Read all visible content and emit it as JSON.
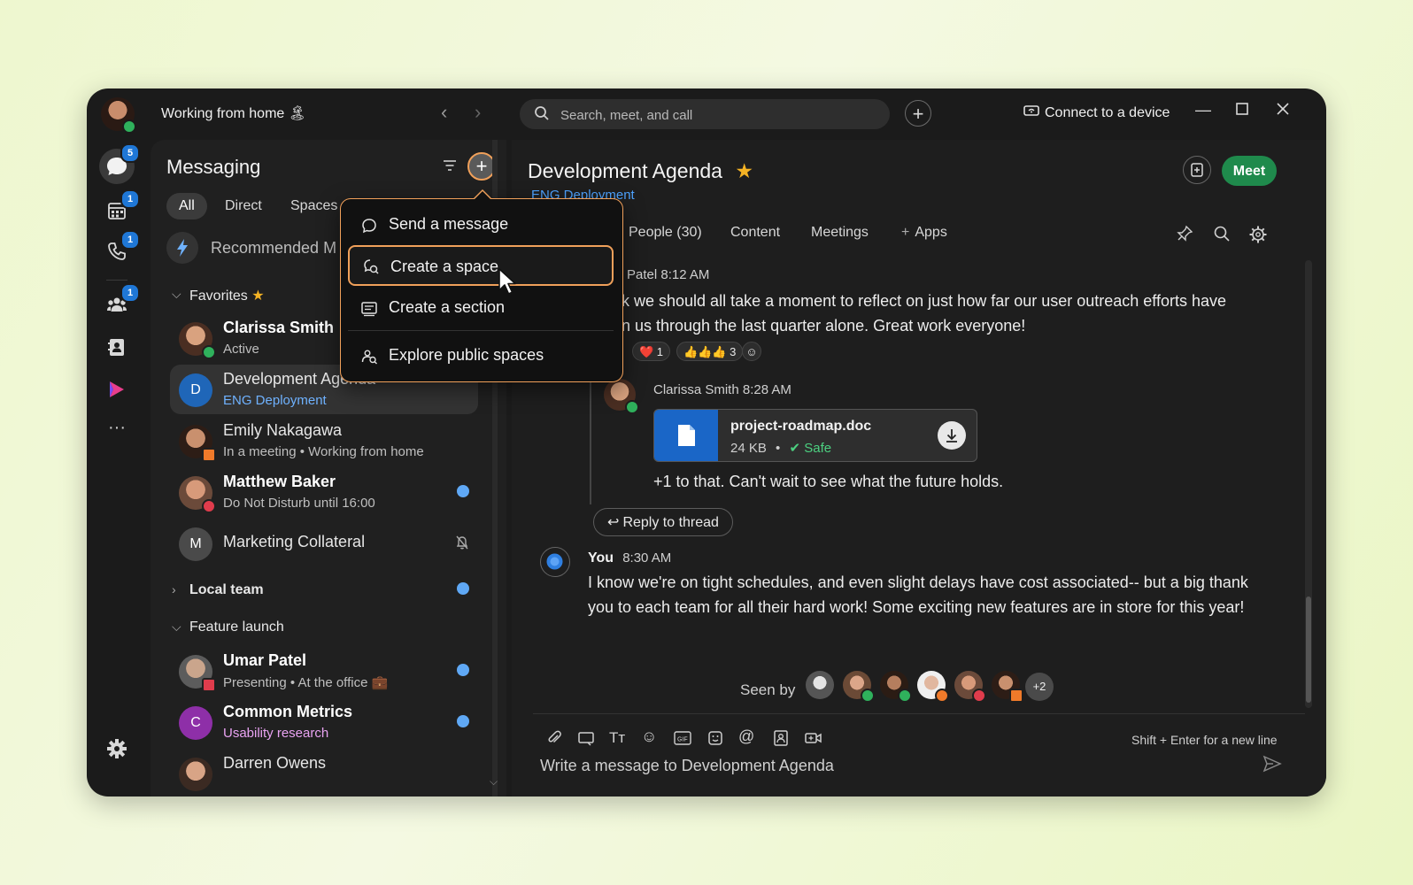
{
  "titlebar": {
    "status": "Working from home 🏝",
    "search_placeholder": "Search, meet, and call",
    "connect_label": "Connect to a device"
  },
  "rail": {
    "badges": {
      "messaging": "5",
      "calendar": "1",
      "calls": "1",
      "teams": "1"
    }
  },
  "messaging": {
    "title": "Messaging",
    "tabs": [
      "All",
      "Direct",
      "Spaces"
    ],
    "recommended": "Recommended M",
    "favorites_label": "Favorites",
    "favorites": [
      {
        "name": "Clarissa Smith",
        "sub": "Active"
      },
      {
        "name": "Development Agenda",
        "sub": "ENG Deployment",
        "letter": "D"
      },
      {
        "name": "Emily Nakagawa",
        "sub": "In a meeting  •  Working from home"
      },
      {
        "name": "Matthew Baker",
        "sub": "Do Not Disturb until 16:00"
      },
      {
        "name": "Marketing Collateral",
        "letter": "M"
      }
    ],
    "local_team_label": "Local team",
    "feature_launch_label": "Feature launch",
    "feature_launch": [
      {
        "name": "Umar Patel",
        "sub": "Presenting  •  At the office 💼"
      },
      {
        "name": "Common Metrics",
        "sub": "Usability research",
        "letter": "C"
      },
      {
        "name": "Darren Owens"
      }
    ]
  },
  "dropdown": {
    "items": [
      "Send a message",
      "Create a space",
      "Create a section",
      "Explore public spaces"
    ]
  },
  "conversation": {
    "title": "Development Agenda",
    "subtitle": "ENG Deployment",
    "meet_label": "Meet",
    "tabs": [
      "People (30)",
      "Content",
      "Meetings",
      "Apps"
    ],
    "msg1_meta": "Patel  8:12 AM",
    "msg1_line1": "k we should all take a moment to reflect on just how far our user outreach efforts have",
    "msg1_line2": "n us through the last quarter alone. Great work everyone!",
    "reactions": [
      "❤️ 1",
      "👍👍👍 3"
    ],
    "reply_meta": "Clarissa Smith  8:28 AM",
    "file_name": "project-roadmap.doc",
    "file_size": "24 KB",
    "file_status": "Safe",
    "reply_text": "+1 to that. Can't wait to see what the future holds.",
    "reply_thread_label": "Reply to thread",
    "you_name": "You",
    "you_time": "8:30 AM",
    "you_line1": "I know we're on tight schedules, and even slight delays have cost associated-- but a big thank",
    "you_line2": "you to each team for all their hard work! Some exciting new features are in store for this year!",
    "seen_by": "Seen by",
    "seen_extra": "+2",
    "hint": "Shift + Enter for a new line",
    "composer_placeholder": "Write a message to Development Agenda"
  },
  "colors": {
    "accent_orange": "#f0a05a",
    "meet_green": "#1f8a4c",
    "link_blue": "#4ea3ff",
    "unread_blue": "#5fa8f5",
    "badge_blue": "#1f77d6"
  }
}
